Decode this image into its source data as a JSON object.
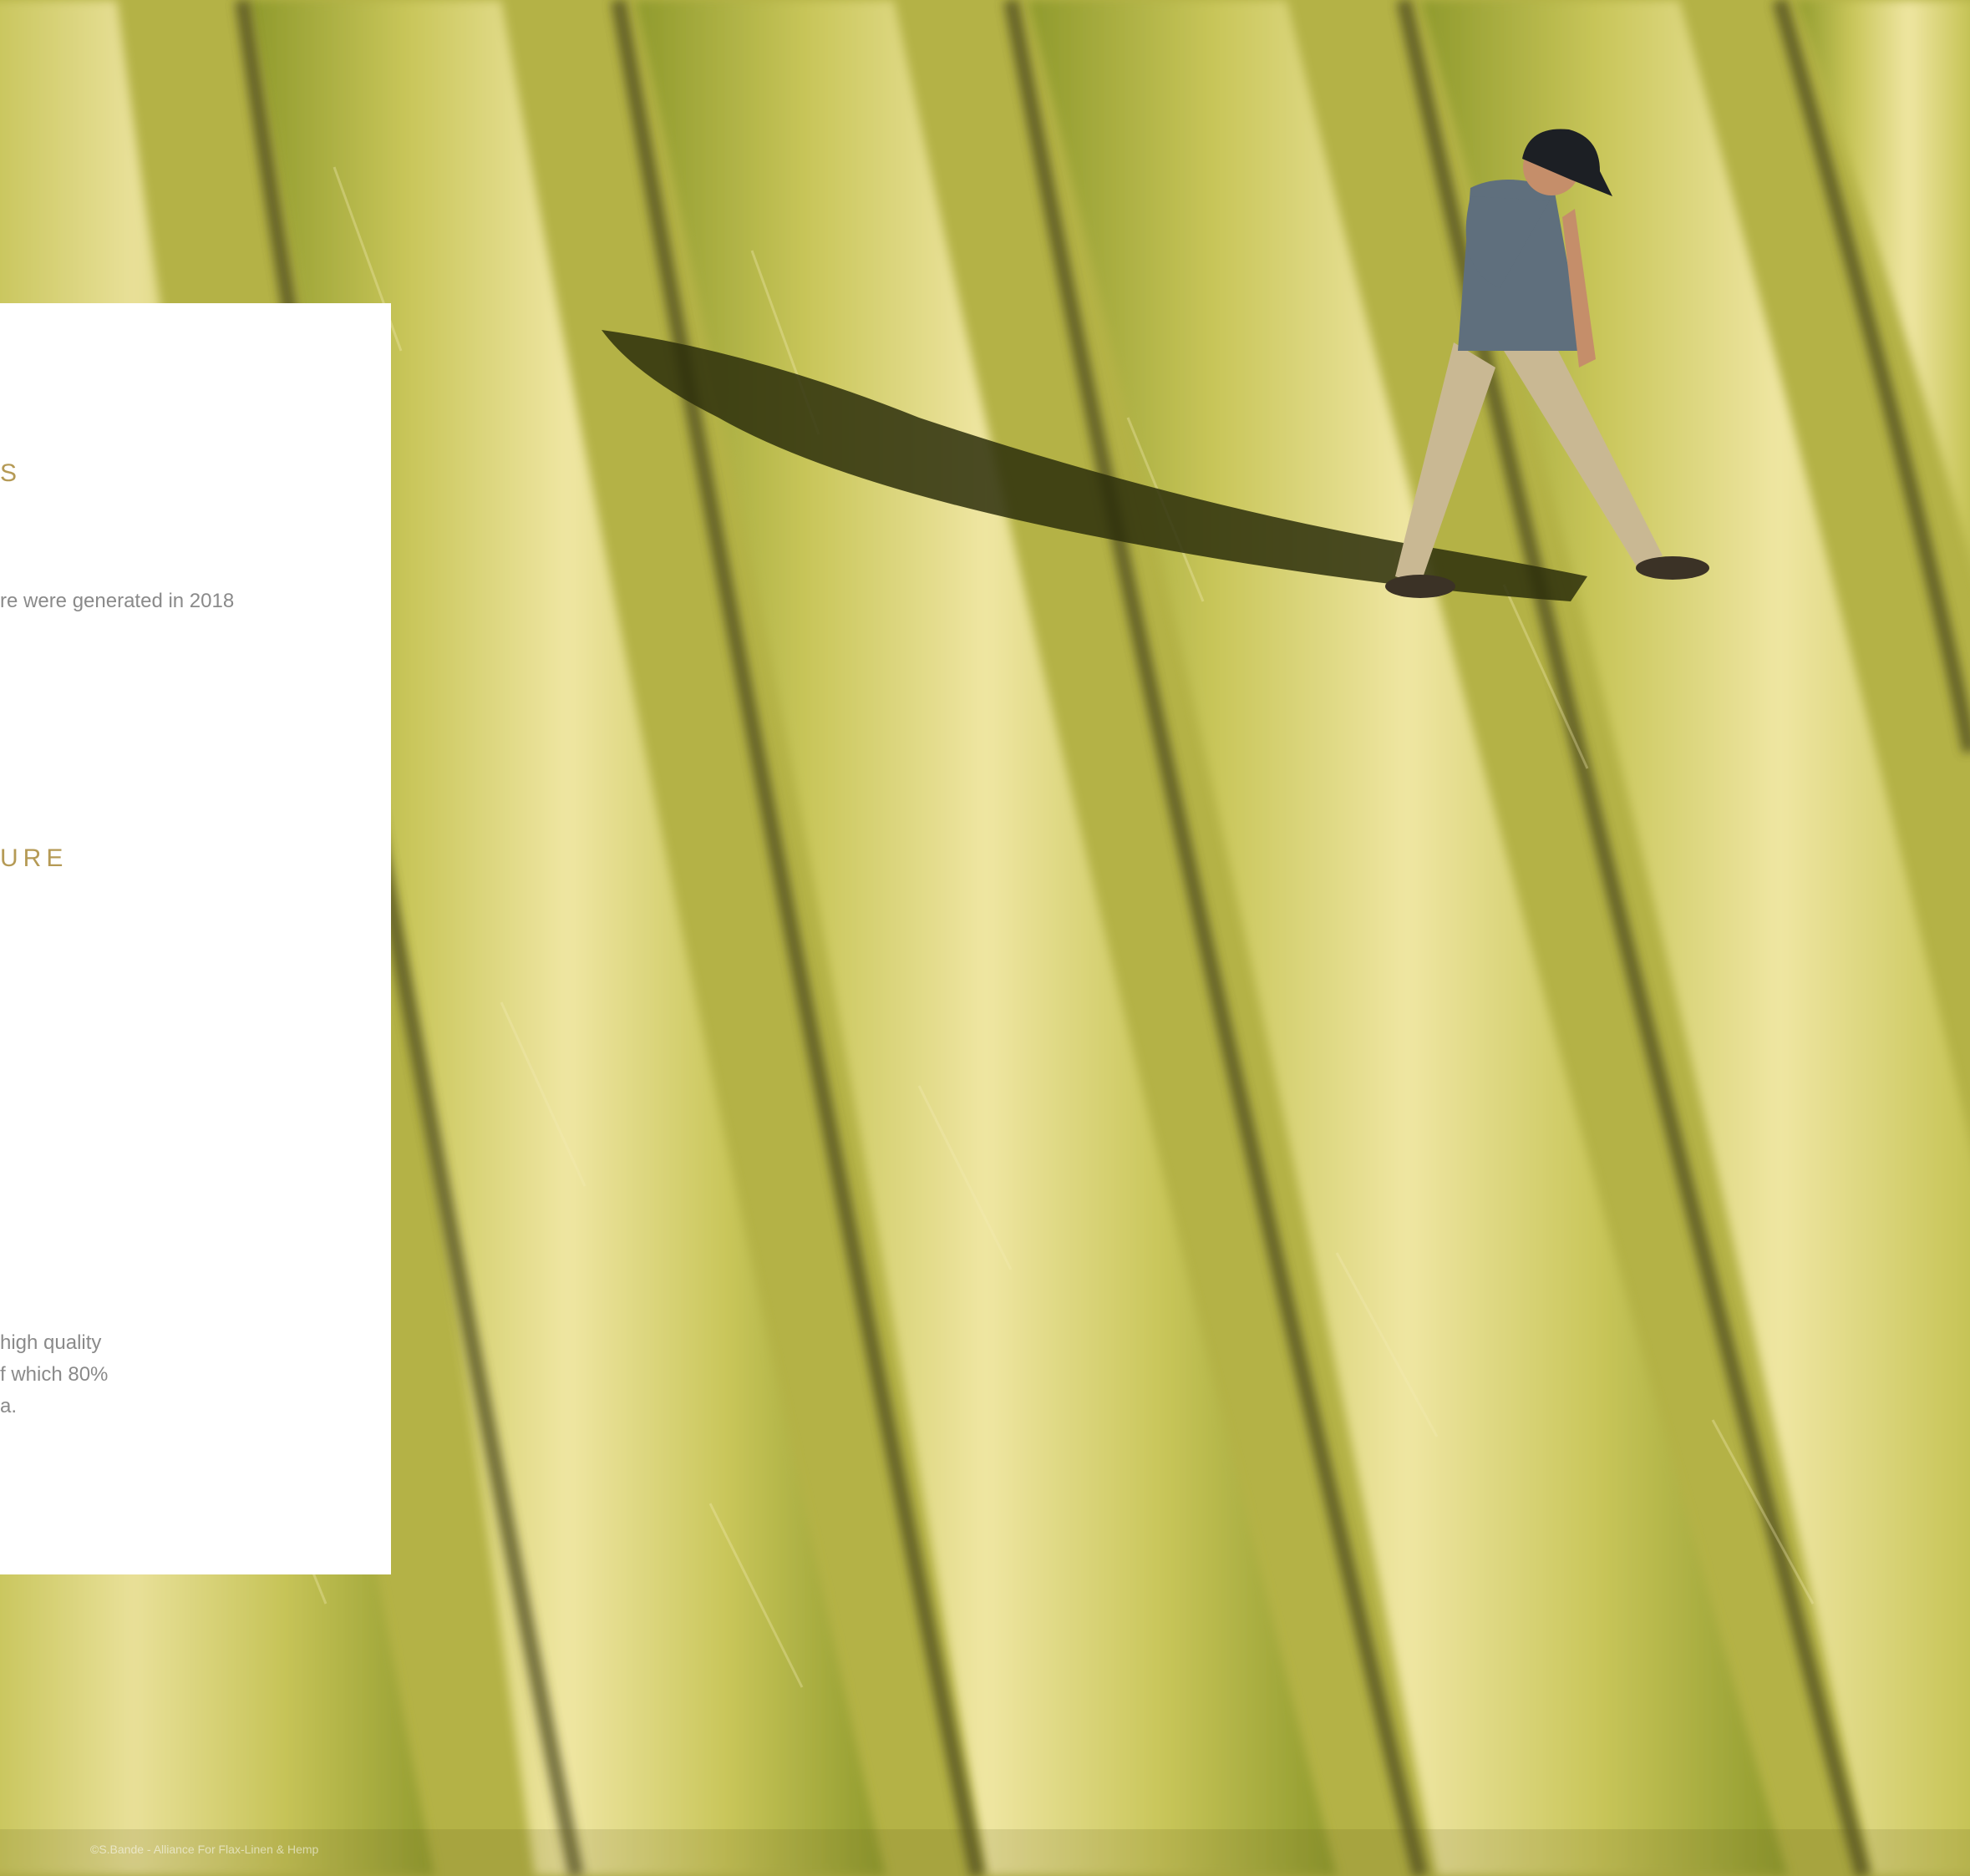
{
  "panel": {
    "heading_1": "S",
    "text_1": "re were generated in 2018",
    "heading_2": "URE",
    "text_2_lines": [
      "high quality",
      "f which 80%",
      "a."
    ]
  },
  "photo_credit": "©S.Bande - Alliance For Flax-Linen & Hemp",
  "colors": {
    "heading": "#b59a55",
    "body_text": "#8a8a8a",
    "panel_bg": "#ffffff",
    "field_light": "#e8df8a",
    "field_green": "#a9a83a",
    "furrow": "#4a4a20"
  }
}
